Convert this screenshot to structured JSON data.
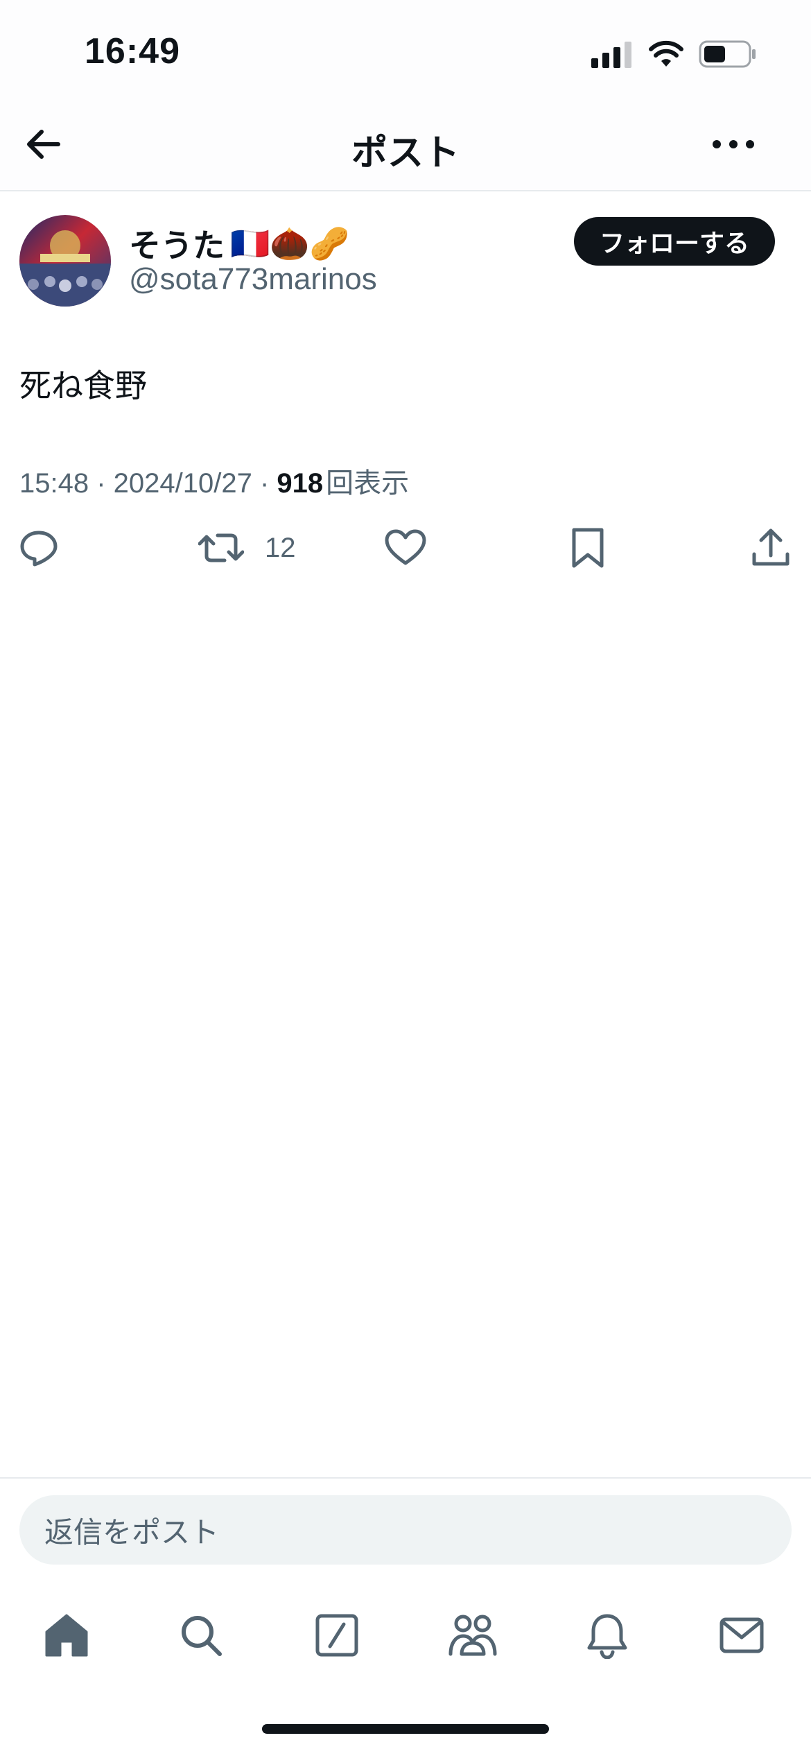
{
  "status_bar": {
    "time": "16:49"
  },
  "nav": {
    "title": "ポスト"
  },
  "post": {
    "author": {
      "name": "そうた",
      "emojis": "🇫🇷🌰🥜",
      "handle": "@sota773marinos"
    },
    "follow_label": "フォローする",
    "text": "死ね食野",
    "meta": {
      "time": "15:48",
      "date": "2024/10/27",
      "sep": " · ",
      "views": "918",
      "views_label": "回表示"
    },
    "actions": {
      "retweet_count": "12"
    }
  },
  "reply": {
    "placeholder": "返信をポスト"
  },
  "tabbar": {
    "icons": [
      "home-icon",
      "search-icon",
      "grok-icon",
      "communities-icon",
      "notifications-icon",
      "messages-icon"
    ]
  },
  "colors": {
    "primary_text": "#0f1419",
    "secondary_text": "#536471",
    "divider": "#e7eaed",
    "reply_bg": "#eff3f4"
  }
}
